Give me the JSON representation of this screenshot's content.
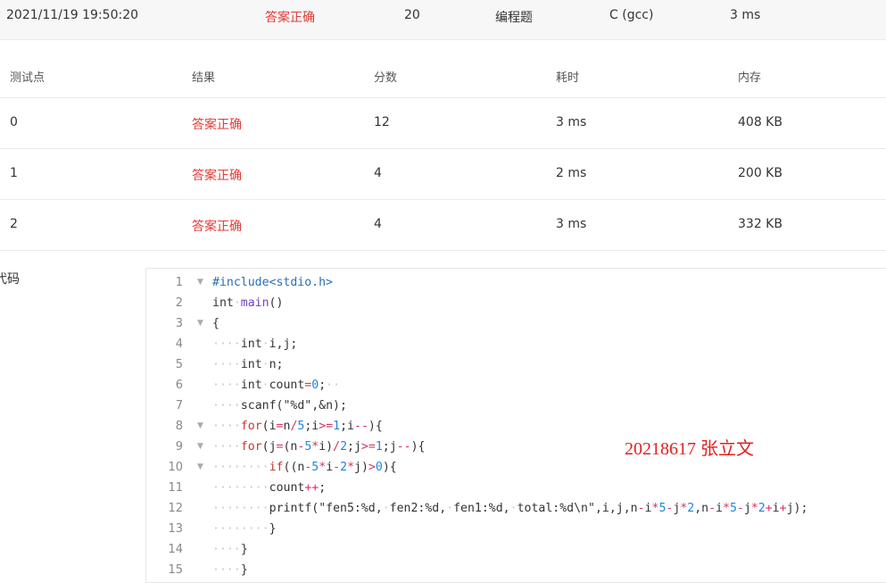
{
  "summary": {
    "timestamp": "2021/11/19 19:50:20",
    "status": "答案正确",
    "score": "20",
    "problem_type": "编程题",
    "compiler": "C (gcc)",
    "time": "3 ms"
  },
  "table": {
    "headers": [
      "测试点",
      "结果",
      "分数",
      "耗时",
      "内存"
    ],
    "rows": [
      {
        "case": "0",
        "result": "答案正确",
        "score": "12",
        "time": "3 ms",
        "memory": "408 KB"
      },
      {
        "case": "1",
        "result": "答案正确",
        "score": "4",
        "time": "2 ms",
        "memory": "200 KB"
      },
      {
        "case": "2",
        "result": "答案正确",
        "score": "4",
        "time": "3 ms",
        "memory": "332 KB"
      }
    ]
  },
  "code_section": {
    "label": "代码",
    "lines": [
      {
        "n": "1",
        "fold": true,
        "text": "#include<stdio.h>"
      },
      {
        "n": "2",
        "fold": false,
        "text": "int·main()"
      },
      {
        "n": "3",
        "fold": true,
        "text": "{"
      },
      {
        "n": "4",
        "fold": false,
        "text": "····int·i,j;"
      },
      {
        "n": "5",
        "fold": false,
        "text": "····int·n;"
      },
      {
        "n": "6",
        "fold": false,
        "text": "····int·count=0;··"
      },
      {
        "n": "7",
        "fold": false,
        "text": "····scanf(\"%d\",&n);"
      },
      {
        "n": "8",
        "fold": true,
        "text": "····for(i=n/5;i>=1;i--){"
      },
      {
        "n": "9",
        "fold": true,
        "text": "····for(j=(n-5*i)/2;j>=1;j--){"
      },
      {
        "n": "10",
        "fold": true,
        "text": "········if((n-5*i-2*j)>0){"
      },
      {
        "n": "11",
        "fold": false,
        "text": "········count++;"
      },
      {
        "n": "12",
        "fold": false,
        "text": "········printf(\"fen5:%d,·fen2:%d,·fen1:%d,·total:%d\\n\",i,j,n-i*5-j*2,n-i*5-j*2+i+j);"
      },
      {
        "n": "13",
        "fold": false,
        "text": "········}"
      },
      {
        "n": "14",
        "fold": false,
        "text": "····}"
      },
      {
        "n": "15",
        "fold": false,
        "text": "····}"
      }
    ]
  },
  "annotation": "20218617  张立文",
  "colors": {
    "accepted": "#e23b35",
    "annotation": "#e02020"
  }
}
